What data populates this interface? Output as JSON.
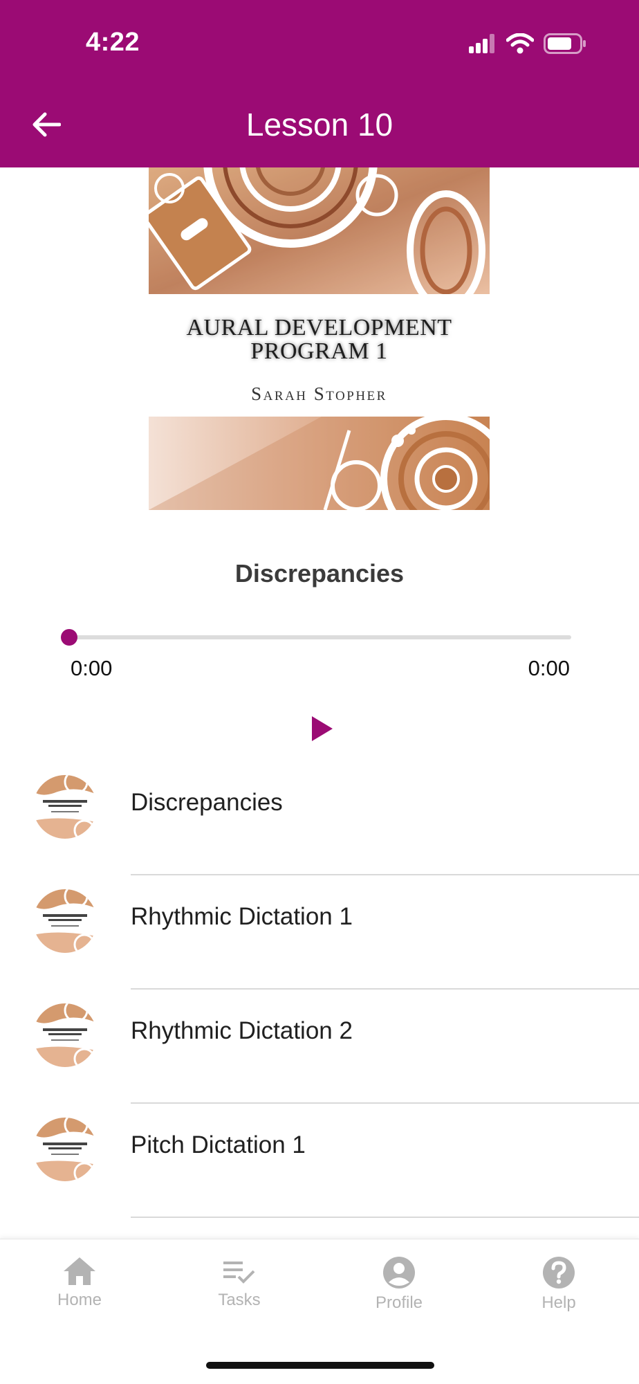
{
  "status_bar": {
    "time": "4:22"
  },
  "header": {
    "title": "Lesson 10"
  },
  "cover": {
    "title_line1": "AURAL DEVELOPMENT",
    "title_line2": "PROGRAM 1",
    "author": "Sarah Stopher"
  },
  "player": {
    "track_title": "Discrepancies",
    "current_time": "0:00",
    "total_time": "0:00",
    "progress": 0,
    "accent_color": "#9b0b74"
  },
  "tracks": [
    {
      "label": "Discrepancies"
    },
    {
      "label": "Rhythmic Dictation 1"
    },
    {
      "label": "Rhythmic Dictation 2"
    },
    {
      "label": "Pitch Dictation 1"
    }
  ],
  "tabbar": {
    "home": "Home",
    "tasks": "Tasks",
    "profile": "Profile",
    "help": "Help"
  },
  "icons": {
    "back": "arrow-left-icon",
    "play": "play-icon",
    "home": "home-icon",
    "tasks": "tasks-icon",
    "profile": "profile-icon",
    "help": "help-icon"
  }
}
